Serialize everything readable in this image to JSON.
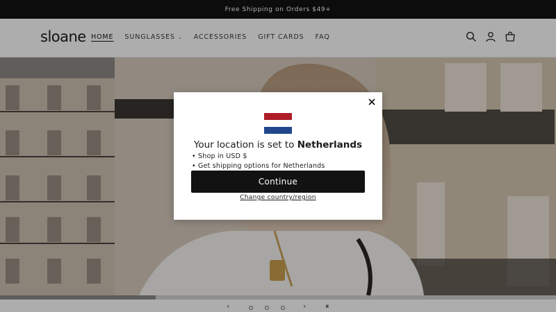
{
  "announcement": "Free Shipping on Orders $49+",
  "header": {
    "logo": "sloane",
    "nav": [
      {
        "label": "HOME",
        "active": true
      },
      {
        "label": "SUNGLASSES",
        "dropdown": true
      },
      {
        "label": "ACCESSORIES"
      },
      {
        "label": "GIFT CARDS"
      },
      {
        "label": "FAQ"
      }
    ],
    "icons": [
      "search-icon",
      "account-icon",
      "cart-icon"
    ]
  },
  "hero": {
    "slideshow": {
      "progress": 0.28,
      "prev_label": "‹",
      "next_label": "›",
      "pause_label": "⏸",
      "slide_count": 3
    }
  },
  "modal": {
    "title_prefix": "Your location is set to ",
    "country": "Netherlands",
    "bullets": [
      "Shop in USD $",
      "Get shipping options for Netherlands"
    ],
    "continue_label": "Continue",
    "change_label": "Change country/region",
    "flag_colors": [
      "#ae1c28",
      "#ffffff",
      "#21468b"
    ]
  },
  "colors": {
    "announcement_bg": "#121212",
    "button_bg": "#121212",
    "overlay": "rgba(0,0,0,0.32)"
  }
}
